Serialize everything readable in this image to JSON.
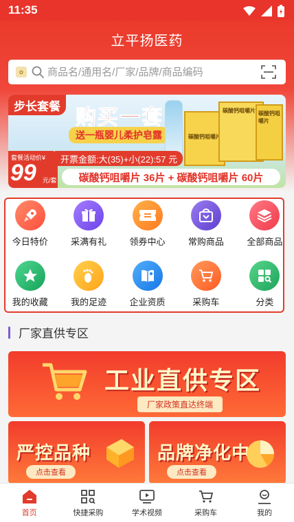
{
  "status": {
    "time": "11:35"
  },
  "app": {
    "title": "立平扬医药"
  },
  "search": {
    "placeholder": "商品名/通用名/厂家/品牌/商品编码"
  },
  "banner": {
    "tag": "步长套餐",
    "headline": "购买一套",
    "subline": "送一瓶婴儿柔护皂露",
    "box_label": "碳酸钙咀嚼片",
    "price_label": "套餐活动价¥",
    "price": "99",
    "price_unit": "元/套",
    "invoice": "开票金额:大(35)+小(22):57 元",
    "combo": "碳酸钙咀嚼片 36片 + 碳酸钙咀嚼片 60片"
  },
  "menu": {
    "row1": [
      {
        "label": "今日特价",
        "icon": "rocket-icon",
        "color": "#ff6a4d"
      },
      {
        "label": "采满有礼",
        "icon": "gift-icon",
        "color": "#8b5cf6"
      },
      {
        "label": "领券中心",
        "icon": "coupon-icon",
        "color": "#ff8a2a"
      },
      {
        "label": "常购商品",
        "icon": "bag-icon",
        "color": "#7b5bd6"
      },
      {
        "label": "全部商品",
        "icon": "layers-icon",
        "color": "#ff4e5c"
      }
    ],
    "row2": [
      {
        "label": "我的收藏",
        "icon": "star-icon",
        "color": "#22b86b"
      },
      {
        "label": "我的足迹",
        "icon": "footprint-icon",
        "color": "#ffb52e"
      },
      {
        "label": "企业资质",
        "icon": "certificate-icon",
        "color": "#2a8ef5"
      },
      {
        "label": "采购车",
        "icon": "cart-icon",
        "color": "#ff6a2a"
      },
      {
        "label": "分类",
        "icon": "category-icon",
        "color": "#2db86f"
      }
    ]
  },
  "section": {
    "title": "厂家直供专区"
  },
  "promos": {
    "big_title": "工业直供专区",
    "big_sub": "厂家政策直达终端",
    "left_title": "严控品种",
    "left_btn": "点击查看",
    "right_title": "品牌净化中",
    "right_btn": "点击查看"
  },
  "tabs": [
    {
      "label": "首页",
      "icon": "home-icon",
      "active": true
    },
    {
      "label": "快捷采购",
      "icon": "grid-scan-icon",
      "active": false
    },
    {
      "label": "学术视频",
      "icon": "video-icon",
      "active": false
    },
    {
      "label": "采购车",
      "icon": "cart-icon",
      "active": false
    },
    {
      "label": "我的",
      "icon": "profile-icon",
      "active": false
    }
  ],
  "colors": {
    "brand": "#e23b2c",
    "accent_purple": "#7b5bd6"
  }
}
